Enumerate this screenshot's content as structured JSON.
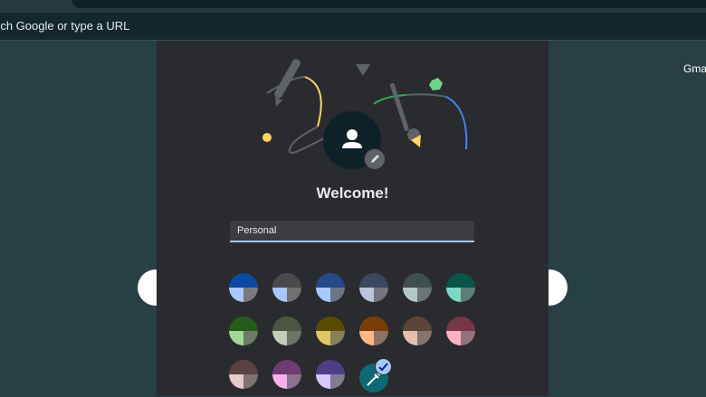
{
  "omnibox": {
    "placeholder": "rch Google or type a URL"
  },
  "ntp": {
    "gmail_link": "Gmail"
  },
  "dialog": {
    "title": "Welcome!",
    "name_value": "Personal",
    "swatches": [
      [
        "#0b4aa3",
        "#a8c7fa",
        "#7a7a7c"
      ],
      [
        "#4a4a4c",
        "#a8c7fa",
        "#707072"
      ],
      [
        "#26498a",
        "#a8c7fa",
        "#6c7488"
      ],
      [
        "#3d4762",
        "#bcc5dc",
        "#74767c"
      ],
      [
        "#3f4f4f",
        "#b6c7c9",
        "#6a7574"
      ],
      [
        "#0b5448",
        "#7bd8c6",
        "#5f7d75"
      ],
      [
        "#265b1c",
        "#a4d896",
        "#6a7b66"
      ],
      [
        "#4b5643",
        "#c3cfba",
        "#6c7467"
      ],
      [
        "#5a4b00",
        "#e0c762",
        "#85805a"
      ],
      [
        "#7a3d05",
        "#ffb784",
        "#8c7264"
      ],
      [
        "#5a4538",
        "#e3c0b0",
        "#857570"
      ],
      [
        "#763648",
        "#ffb0c4",
        "#94727c"
      ],
      [
        "#5a4244",
        "#e7c8cb",
        "#7e7273"
      ],
      [
        "#6e3b72",
        "#f7b0ec",
        "#8c7290"
      ],
      [
        "#4e3e85",
        "#d7c6ff",
        "#827a92"
      ]
    ],
    "custom_color": "#0d6a70",
    "accent": "#a8c7fa"
  }
}
